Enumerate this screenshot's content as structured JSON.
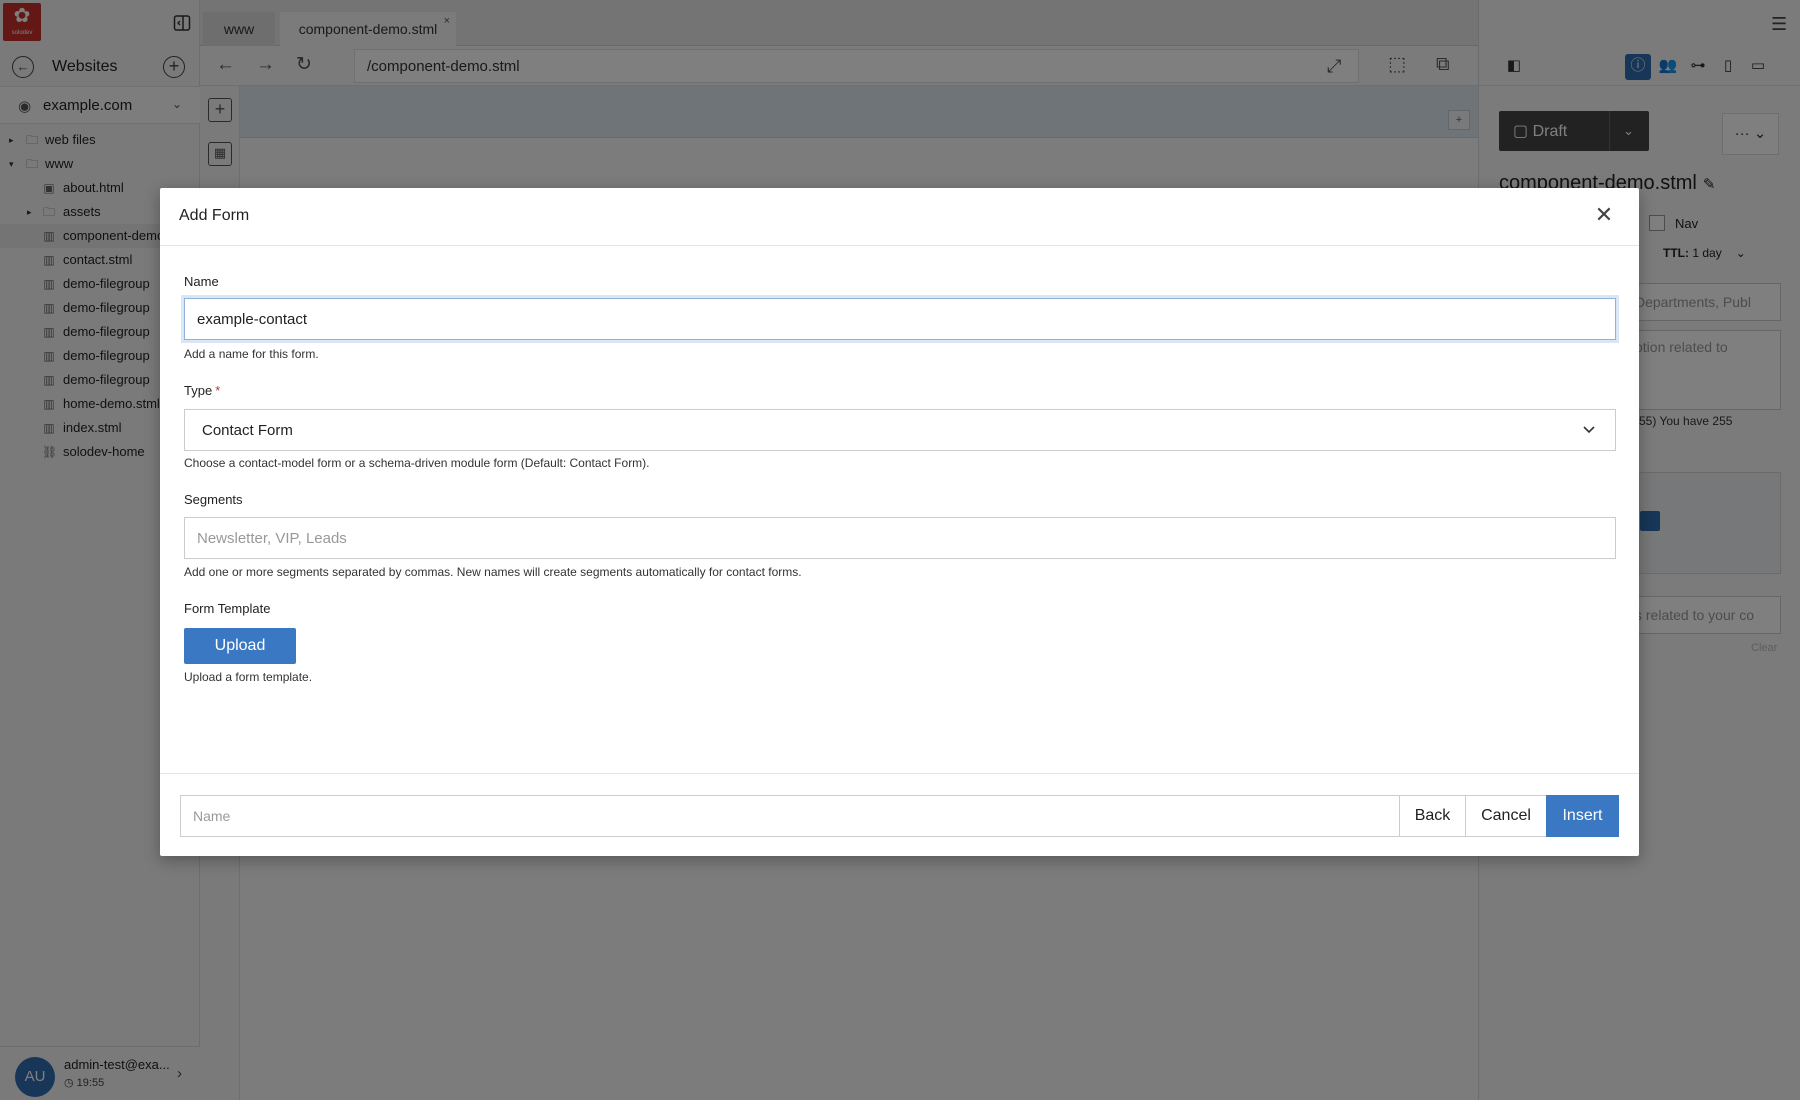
{
  "app": {
    "logo_text": "solodev",
    "header": {
      "sites_title": "Websites",
      "site_selected": "example.com"
    }
  },
  "tree": [
    {
      "label": "web files",
      "type": "folder",
      "level": 0,
      "caret": "▸"
    },
    {
      "label": "www",
      "type": "folder",
      "level": 0,
      "caret": "▾"
    },
    {
      "label": "about.html",
      "type": "file",
      "level": 1
    },
    {
      "label": "assets",
      "type": "folder",
      "level": 1,
      "caret": "▸"
    },
    {
      "label": "component-demo.stml",
      "type": "page",
      "level": 1
    },
    {
      "label": "contact.stml",
      "type": "page",
      "level": 1
    },
    {
      "label": "demo-filegroup",
      "type": "page",
      "level": 1
    },
    {
      "label": "demo-filegroup",
      "type": "page",
      "level": 1
    },
    {
      "label": "demo-filegroup",
      "type": "page",
      "level": 1
    },
    {
      "label": "demo-filegroup",
      "type": "page",
      "level": 1
    },
    {
      "label": "demo-filegroup",
      "type": "page",
      "level": 1
    },
    {
      "label": "home-demo.stml",
      "type": "page",
      "level": 1
    },
    {
      "label": "index.stml",
      "type": "page",
      "level": 1
    },
    {
      "label": "solodev-home",
      "type": "link",
      "level": 1
    }
  ],
  "user": {
    "initials": "AU",
    "email": "admin-test@exa...",
    "time": "19:55"
  },
  "tabs": [
    {
      "label": "www"
    },
    {
      "label": "component-demo.stml"
    }
  ],
  "browser": {
    "url": "/component-demo.stml"
  },
  "right_panel": {
    "status": "Draft",
    "filename": "component-demo.stml",
    "nav_label": "Nav",
    "ttl_label": "TTL:",
    "ttl_value": "1 day",
    "categories_placeholder": "Departments, Publ",
    "description_placeholder": "ption related to",
    "char_count": "55) You have 255",
    "keywords_placeholder": "s related to your co",
    "clear_label": "Clear"
  },
  "modal": {
    "title": "Add Form",
    "name_label": "Name",
    "name_value": "example-contact",
    "name_help": "Add a name for this form.",
    "type_label": "Type",
    "type_required": "*",
    "type_value": "Contact Form",
    "type_help": "Choose a contact-model form or a schema-driven module form (Default: Contact Form).",
    "segments_label": "Segments",
    "segments_placeholder": "Newsletter, VIP, Leads",
    "segments_help": "Add one or more segments separated by commas. New names will create segments automatically for contact forms.",
    "template_label": "Form Template",
    "upload_label": "Upload",
    "upload_help": "Upload a form template.",
    "footer_placeholder": "Name",
    "back_label": "Back",
    "cancel_label": "Cancel",
    "insert_label": "Insert"
  },
  "colors": {
    "primary": "#3a78c3",
    "brand": "#c9302c",
    "draft": "#444444",
    "overlay": "rgba(0,0,0,0.5)"
  }
}
